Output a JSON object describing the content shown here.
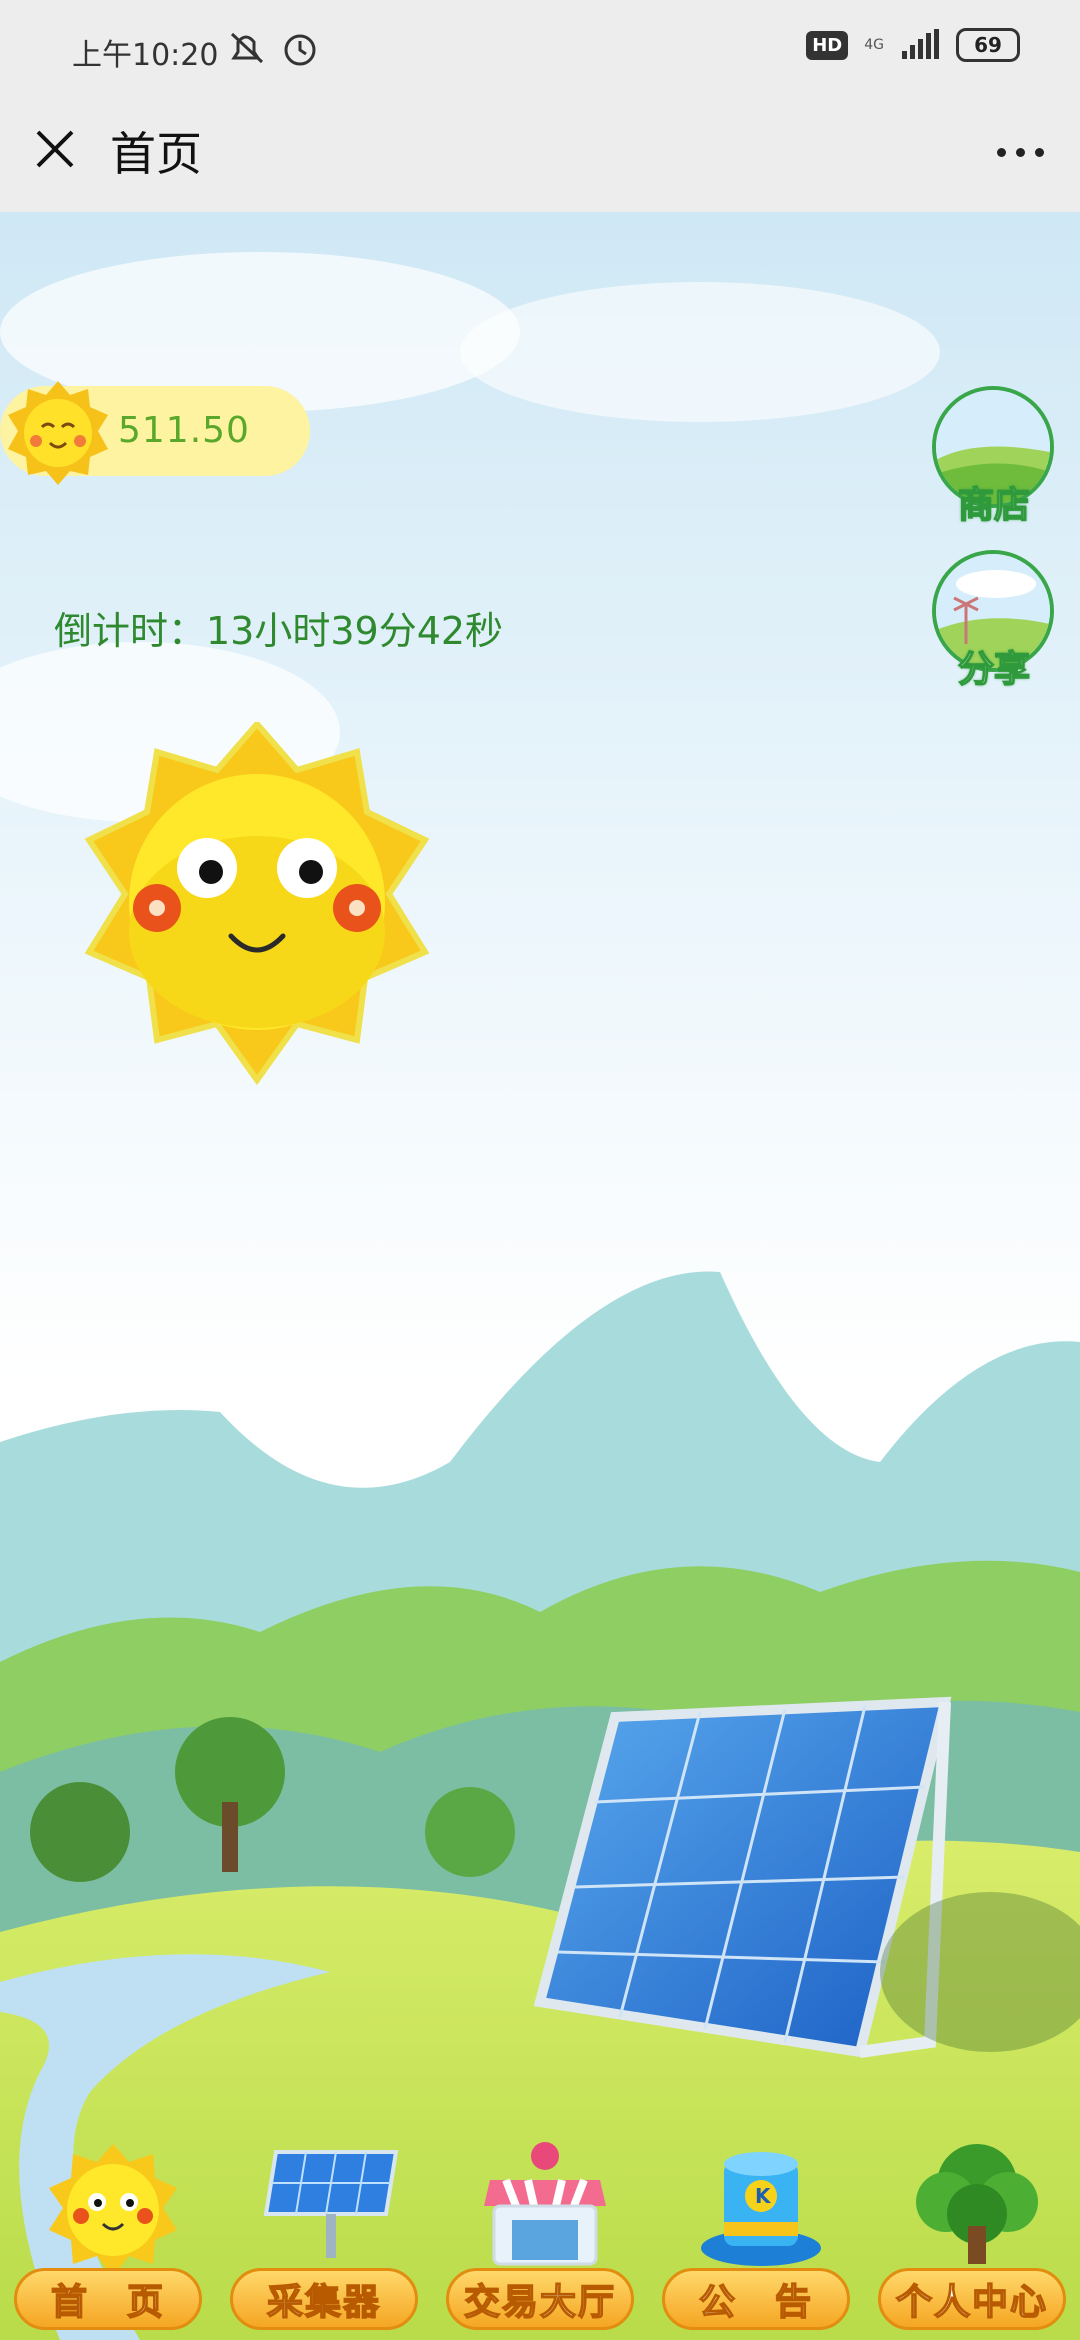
{
  "status_bar": {
    "time": "上午10:20",
    "hd_badge": "HD",
    "network": "4G",
    "battery": "69"
  },
  "nav": {
    "title": "首页"
  },
  "balance": {
    "value": "511.50"
  },
  "countdown": {
    "text": "倒计时：13小时39分42秒"
  },
  "side_buttons": [
    {
      "label": "商店",
      "icon": "shop-icon"
    },
    {
      "label": "分享",
      "icon": "share-icon"
    }
  ],
  "tabs": [
    {
      "label": "首　页",
      "icon": "sun-icon"
    },
    {
      "label": "采集器",
      "icon": "solar-panel-icon"
    },
    {
      "label": "交易大厅",
      "icon": "store-icon"
    },
    {
      "label": "公　告",
      "icon": "hat-icon"
    },
    {
      "label": "个人中心",
      "icon": "tree-icon"
    }
  ],
  "colors": {
    "accent_green": "#2f8a2f",
    "coin_text": "#5aa82b",
    "tab_orange": "#f5a623"
  }
}
